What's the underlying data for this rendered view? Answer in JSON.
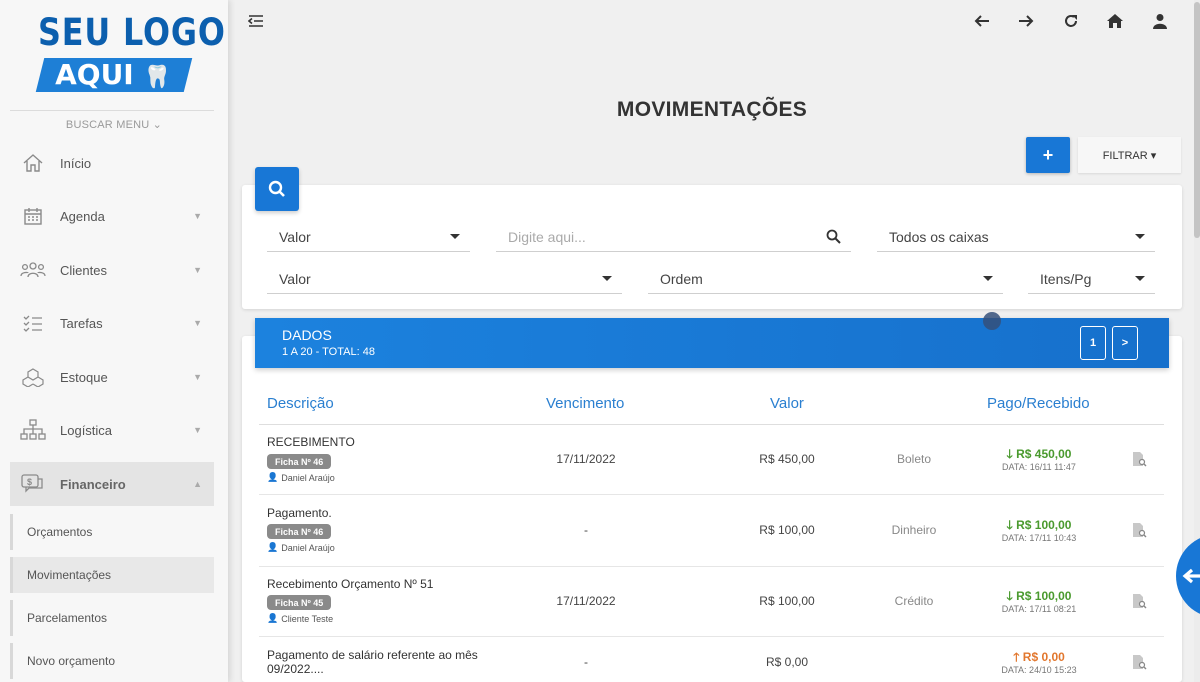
{
  "logo": {
    "line1": "SEU LOGO",
    "line2": "AQUI"
  },
  "sidebar": {
    "search_label": "BUSCAR MENU ⌄",
    "items": [
      {
        "label": "Início",
        "icon": "home-icon",
        "has_caret": false
      },
      {
        "label": "Agenda",
        "icon": "calendar-icon",
        "has_caret": true
      },
      {
        "label": "Clientes",
        "icon": "users-icon",
        "has_caret": true
      },
      {
        "label": "Tarefas",
        "icon": "tasks-icon",
        "has_caret": true
      },
      {
        "label": "Estoque",
        "icon": "boxes-icon",
        "has_caret": true
      },
      {
        "label": "Logística",
        "icon": "sitemap-icon",
        "has_caret": true
      },
      {
        "label": "Financeiro",
        "icon": "money-icon",
        "has_caret": true,
        "active": true
      }
    ],
    "subitems": [
      {
        "label": "Orçamentos"
      },
      {
        "label": "Movimentações",
        "active": true
      },
      {
        "label": "Parcelamentos"
      },
      {
        "label": "Novo orçamento"
      }
    ]
  },
  "topbar": {
    "icons": [
      "menu-collapse-icon",
      "arrow-left-icon",
      "arrow-right-icon",
      "reload-icon",
      "home-icon",
      "user-icon"
    ]
  },
  "page": {
    "title": "MOVIMENTAÇÕES",
    "add_label": "+",
    "filter_label": "FILTRAR ▾"
  },
  "filters": {
    "field1": "Valor",
    "search_placeholder": "Digite aqui...",
    "caixas": "Todos os caixas",
    "field2": "Valor",
    "ordem": "Ordem",
    "itens": "Itens/Pg"
  },
  "dados": {
    "title": "DADOS",
    "subtitle": "1 A 20 - TOTAL: 48",
    "page_current": "1",
    "page_next": ">"
  },
  "table": {
    "headers": {
      "descricao": "Descrição",
      "vencimento": "Vencimento",
      "valor": "Valor",
      "pago": "Pago/Recebido"
    },
    "rows": [
      {
        "descricao": "RECEBIMENTO",
        "ficha": "Ficha Nº 46",
        "pessoa": "Daniel Araújo",
        "vencimento": "17/11/2022",
        "valor": "R$ 450,00",
        "forma": "Boleto",
        "pago_valor": "R$ 450,00",
        "pago_dir": "down",
        "pago_data": "DATA: 16/11 11:47"
      },
      {
        "descricao": "Pagamento.",
        "ficha": "Ficha Nº 46",
        "pessoa": "Daniel Araújo",
        "vencimento": "-",
        "valor": "R$ 100,00",
        "forma": "Dinheiro",
        "pago_valor": "R$ 100,00",
        "pago_dir": "down",
        "pago_data": "DATA: 17/11 10:43"
      },
      {
        "descricao": "Recebimento Orçamento Nº 51",
        "ficha": "Ficha Nº 45",
        "pessoa": "Cliente Teste",
        "vencimento": "17/11/2022",
        "valor": "R$ 100,00",
        "forma": "Crédito",
        "pago_valor": "R$ 100,00",
        "pago_dir": "down",
        "pago_data": "DATA: 17/11 08:21"
      },
      {
        "descricao": "Pagamento de salário referente ao mês 09/2022....",
        "ficha": "",
        "pessoa": "",
        "vencimento": "-",
        "valor": "R$ 0,00",
        "forma": "",
        "pago_valor": "R$ 0,00",
        "pago_dir": "up",
        "pago_data": "DATA: 24/10 15:23"
      }
    ]
  },
  "colors": {
    "primary": "#1877d6",
    "green": "#4a9a2e",
    "orange": "#e2772e",
    "header_text": "#2a7fd0"
  }
}
